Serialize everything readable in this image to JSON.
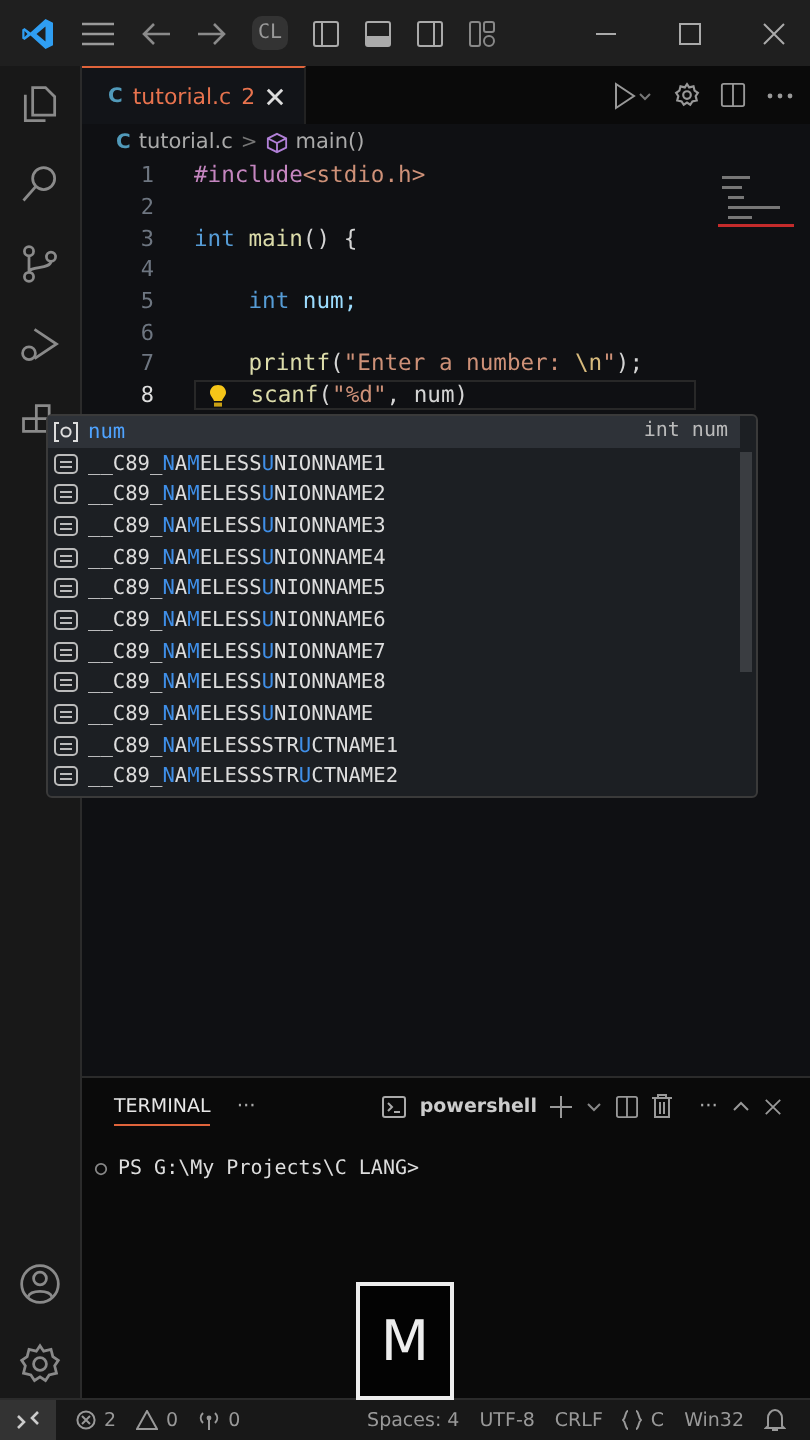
{
  "title_bar": {
    "command_center": "CL"
  },
  "tabs": [
    {
      "lang": "C",
      "name": "tutorial.c",
      "problems": "2",
      "selected": true
    }
  ],
  "breadcrumb": {
    "lang": "C",
    "file": "tutorial.c",
    "separator": ">",
    "symbol": "main()"
  },
  "code_lines": [
    {
      "number": "1",
      "current": false,
      "lightbulb": false,
      "tokens": [
        {
          "kind": "directive",
          "text": "#include"
        },
        {
          "kind": "string",
          "text": "<stdio.h>"
        }
      ]
    },
    {
      "number": "2",
      "current": false,
      "lightbulb": false
    },
    {
      "number": "3",
      "current": false,
      "lightbulb": false,
      "tokens": [
        {
          "kind": "keyword",
          "text": "int"
        },
        {
          "kind": "function",
          "text": " main"
        },
        {
          "kind": "punct",
          "text": "() {"
        }
      ]
    },
    {
      "number": "4",
      "current": false,
      "lightbulb": false
    },
    {
      "number": "5",
      "current": false,
      "lightbulb": false,
      "tokens": [
        {
          "kind": "keyword",
          "text": "    int"
        },
        {
          "kind": "plain",
          "text": " num;"
        }
      ]
    },
    {
      "number": "6",
      "current": false,
      "lightbulb": false
    },
    {
      "number": "7",
      "current": false,
      "lightbulb": false,
      "tokens": [
        {
          "kind": "function",
          "text": "    printf"
        },
        {
          "kind": "punct",
          "text": "("
        },
        {
          "kind": "string",
          "text": "\"Enter a number: "
        },
        {
          "kind": "escape",
          "text": "\\n"
        },
        {
          "kind": "string",
          "text": "\""
        },
        {
          "kind": "punct",
          "text": ");"
        }
      ]
    },
    {
      "number": "8",
      "current": true,
      "lightbulb": true,
      "tokens": [
        {
          "kind": "function",
          "text": "    scanf"
        },
        {
          "kind": "punct",
          "text": "("
        },
        {
          "kind": "string",
          "text": "\"%d\""
        },
        {
          "kind": "punct",
          "text": ", num)"
        }
      ]
    }
  ],
  "suggestions": {
    "detail": "int num",
    "items": [
      {
        "kind": "variable",
        "label": "num",
        "selected": true
      },
      {
        "kind": "struct",
        "label": "__C89_**N**A**M**ELESS**U**NIONNAME1",
        "selected": false
      },
      {
        "kind": "struct",
        "label": "__C89_**N**A**M**ELESS**U**NIONNAME2",
        "selected": false
      },
      {
        "kind": "struct",
        "label": "__C89_**N**A**M**ELESS**U**NIONNAME3",
        "selected": false
      },
      {
        "kind": "struct",
        "label": "__C89_**N**A**M**ELESS**U**NIONNAME4",
        "selected": false
      },
      {
        "kind": "struct",
        "label": "__C89_**N**A**M**ELESS**U**NIONNAME5",
        "selected": false
      },
      {
        "kind": "struct",
        "label": "__C89_**N**A**M**ELESS**U**NIONNAME6",
        "selected": false
      },
      {
        "kind": "struct",
        "label": "__C89_**N**A**M**ELESS**U**NIONNAME7",
        "selected": false
      },
      {
        "kind": "struct",
        "label": "__C89_**N**A**M**ELESS**U**NIONNAME8",
        "selected": false
      },
      {
        "kind": "struct",
        "label": "__C89_**N**A**M**ELESS**U**NIONNAME",
        "selected": false
      },
      {
        "kind": "struct",
        "label": "__C89_**N**A**M**ELESSSTR**U**CTNAME1",
        "selected": false
      },
      {
        "kind": "struct",
        "label": "__C89_**N**A**M**ELESSSTR**U**CTNAME2",
        "selected": false
      }
    ]
  },
  "panel": {
    "tabs": [
      {
        "label": "TERMINAL",
        "selected": true
      }
    ],
    "more": "···",
    "shell": "powershell",
    "actions_more": "···",
    "prompt": "PS G:\\My Projects\\C LANG>"
  },
  "key_overlay": "M",
  "status_bar": {
    "errors": "2",
    "warnings": "0",
    "ports": "0",
    "items": [
      "Spaces: 4",
      "UTF-8",
      "CRLF"
    ],
    "language": "C",
    "platform": "Win32"
  }
}
